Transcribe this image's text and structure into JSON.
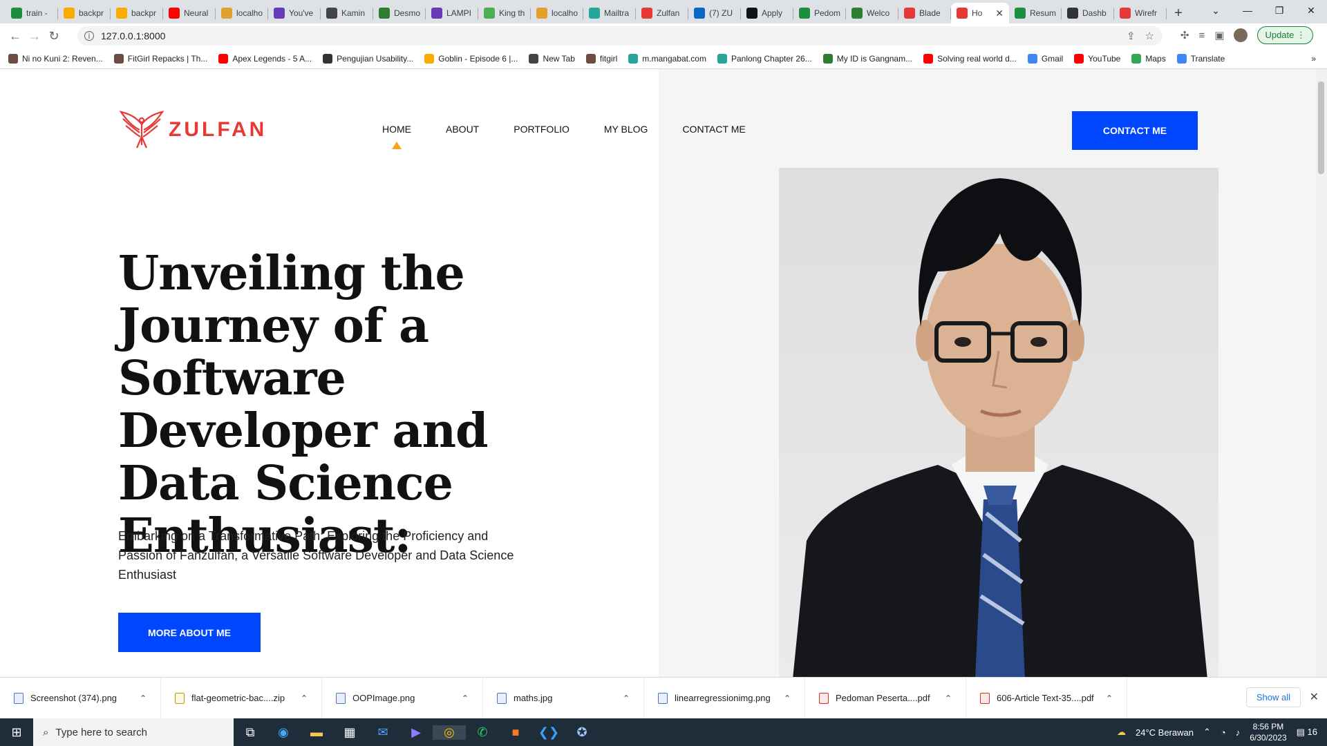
{
  "browser": {
    "tabs": [
      {
        "title": "train -",
        "color": "#1e8e3e"
      },
      {
        "title": "backpr",
        "color": "#f9ab00"
      },
      {
        "title": "backpr",
        "color": "#f9ab00"
      },
      {
        "title": "Neural",
        "color": "#ff0000"
      },
      {
        "title": "localho",
        "color": "#e0a030"
      },
      {
        "title": "You've",
        "color": "#673ab7"
      },
      {
        "title": "Kamin",
        "color": "#444444"
      },
      {
        "title": "Desmo",
        "color": "#2e7d32"
      },
      {
        "title": "LAMPI",
        "color": "#673ab7"
      },
      {
        "title": "King th",
        "color": "#4caf50"
      },
      {
        "title": "localho",
        "color": "#e0a030"
      },
      {
        "title": "Mailtra",
        "color": "#26a69a"
      },
      {
        "title": "Zulfan",
        "color": "#e53935"
      },
      {
        "title": "(7) ZU",
        "color": "#0a66c2"
      },
      {
        "title": "Apply",
        "color": "#111111"
      },
      {
        "title": "Pedom",
        "color": "#1e8e3e"
      },
      {
        "title": "Welco",
        "color": "#2e7d32"
      },
      {
        "title": "Blade",
        "color": "#e53935"
      },
      {
        "title": "Ho",
        "color": "#e53935",
        "active": true
      },
      {
        "title": "Resum",
        "color": "#1e8e3e"
      },
      {
        "title": "Dashb",
        "color": "#333333"
      },
      {
        "title": "Wirefr",
        "color": "#e53935"
      }
    ],
    "new_tab": "+",
    "address": "127.0.0.1:8000",
    "update_label": "Update",
    "bookmarks": [
      {
        "label": "Ni no Kuni 2: Reven...",
        "color": "#6d4c41"
      },
      {
        "label": "FitGirl Repacks | Th...",
        "color": "#6d4c41"
      },
      {
        "label": "Apex Legends - 5 A...",
        "color": "#ff0000"
      },
      {
        "label": "Pengujian Usability...",
        "color": "#333333"
      },
      {
        "label": "Goblin - Episode 6 |...",
        "color": "#f9ab00"
      },
      {
        "label": "New Tab",
        "color": "#444444"
      },
      {
        "label": "fitgirl",
        "color": "#6d4c41"
      },
      {
        "label": "m.mangabat.com",
        "color": "#26a69a"
      },
      {
        "label": "Panlong Chapter 26...",
        "color": "#26a69a"
      },
      {
        "label": "My ID is Gangnam...",
        "color": "#2e7d32"
      },
      {
        "label": "Solving real world d...",
        "color": "#ff0000"
      },
      {
        "label": "Gmail",
        "color": "#4285f4"
      },
      {
        "label": "YouTube",
        "color": "#ff0000"
      },
      {
        "label": "Maps",
        "color": "#34a853"
      },
      {
        "label": "Translate",
        "color": "#4285f4"
      }
    ]
  },
  "site": {
    "logo_text": "ZULFAN",
    "nav": [
      "HOME",
      "ABOUT",
      "PORTFOLIO",
      "MY BLOG",
      "CONTACT ME"
    ],
    "contact_button": "CONTACT ME",
    "hero_title": "Unveiling the Journey of a Software Developer and Data Science Enthusiast:",
    "hero_subtitle": "Embarking on a Transformative Path: Exploring the Proficiency and Passion of Fanzulfan, a Versatile Software Developer and Data Science Enthusiast",
    "more_button": "MORE ABOUT ME",
    "accent_color": "#0046ff",
    "nav_indicator_color": "#f5a623"
  },
  "downloads": {
    "items": [
      "Screenshot (374).png",
      "flat-geometric-bac....zip",
      "OOPImage.png",
      "maths.jpg",
      "linearregressionimg.png",
      "Pedoman Peserta....pdf",
      "606-Article Text-35....pdf"
    ],
    "show_all": "Show all"
  },
  "taskbar": {
    "search_placeholder": "Type here to search",
    "weather": "24°C  Berawan",
    "time": "8:56 PM",
    "date": "6/30/2023",
    "notification_count": "16"
  }
}
